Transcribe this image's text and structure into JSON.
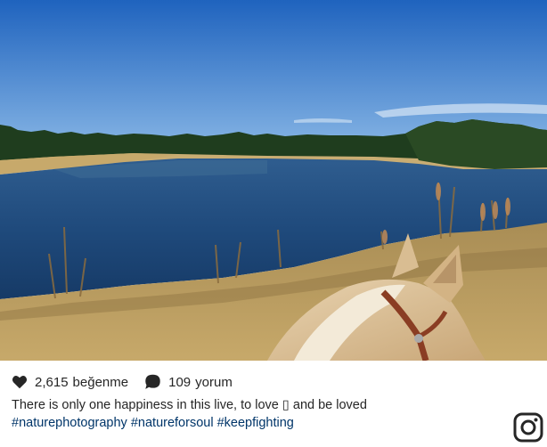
{
  "post": {
    "likes_count": "2,615",
    "likes_label": "beğenme",
    "comments_count": "109",
    "comments_label": "yorum",
    "caption_text": "There is only one happiness in this live, to love",
    "caption_emoji": "▯",
    "caption_tail": "and be loved",
    "hashtags": [
      "#naturephotography",
      "#natureforsoul",
      "#keepfighting"
    ]
  },
  "icons": {
    "like": "heart-icon",
    "comment": "comment-bubble-icon",
    "brand": "instagram-logo-icon"
  },
  "colors": {
    "text": "#262626",
    "hashtag": "#003569",
    "sky": "#2f72c7",
    "water": "#234e86",
    "grass": "#b89a5c"
  }
}
